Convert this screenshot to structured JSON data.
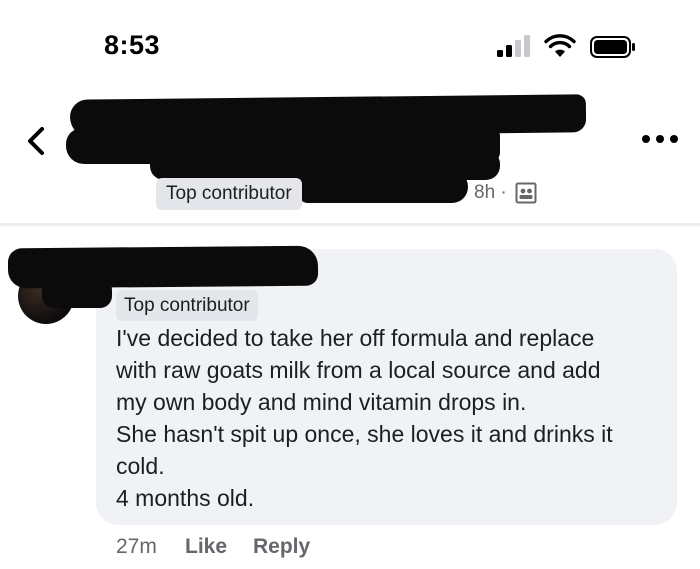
{
  "status_bar": {
    "time": "8:53",
    "icons": [
      "signal-icon",
      "wifi-icon",
      "battery-icon"
    ]
  },
  "post_header": {
    "badge": "Top contributor",
    "time": "8h ·",
    "icons": [
      "back-chevron-icon",
      "more-icon",
      "audience-icon"
    ]
  },
  "comment": {
    "badge": "Top contributor",
    "lines": [
      "I've decided to take her off formula and replace",
      "with raw goats milk from a local source and add",
      "my own body and mind vitamin drops in.",
      "She hasn't spit up once, she loves it and drinks it",
      "cold.",
      "4 months old."
    ],
    "time": "27m",
    "like_label": "Like",
    "reply_label": "Reply"
  },
  "colors": {
    "bubble": "#f0f2f5",
    "badge": "#e4e6eb",
    "secondary_text": "#65676b",
    "redaction": "#0b0b0b"
  }
}
